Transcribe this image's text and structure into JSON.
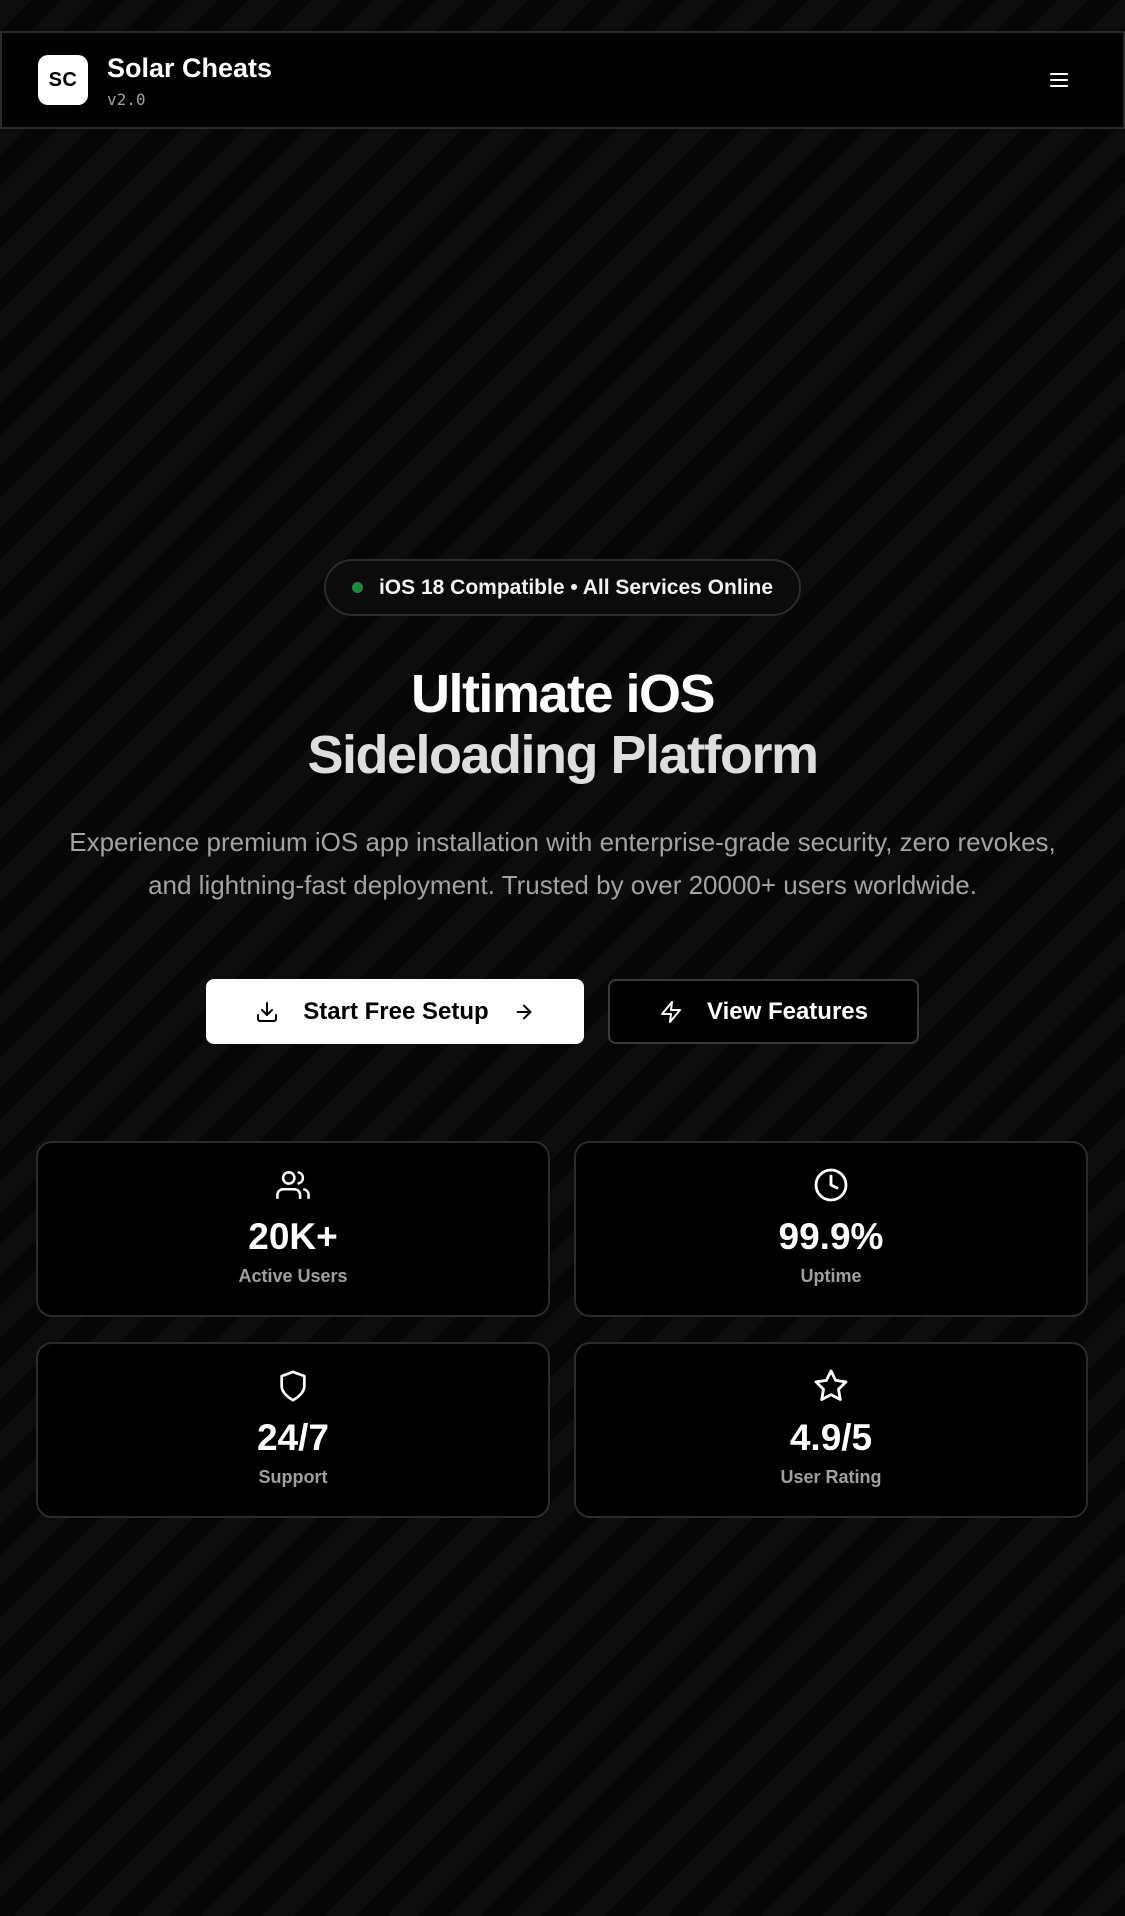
{
  "header": {
    "logo_text": "SC",
    "title": "Solar Cheats",
    "version": "v2.0",
    "menu_icon": "menu-icon"
  },
  "hero": {
    "status_text": "iOS 18 Compatible • All Services Online",
    "status_color": "#1f8a3e",
    "headline_line1": "Ultimate iOS",
    "headline_line2": "Sideloading Platform",
    "subtitle": "Experience premium iOS app installation with enterprise-grade security, zero revokes, and lightning-fast deployment. Trusted by over 20000+ users worldwide.",
    "primary_button": "Start Free Setup",
    "secondary_button": "View Features"
  },
  "stats": [
    {
      "icon": "users-icon",
      "value": "20K+",
      "label": "Active Users"
    },
    {
      "icon": "clock-icon",
      "value": "99.9%",
      "label": "Uptime"
    },
    {
      "icon": "shield-icon",
      "value": "24/7",
      "label": "Support"
    },
    {
      "icon": "star-icon",
      "value": "4.9/5",
      "label": "User Rating"
    }
  ]
}
